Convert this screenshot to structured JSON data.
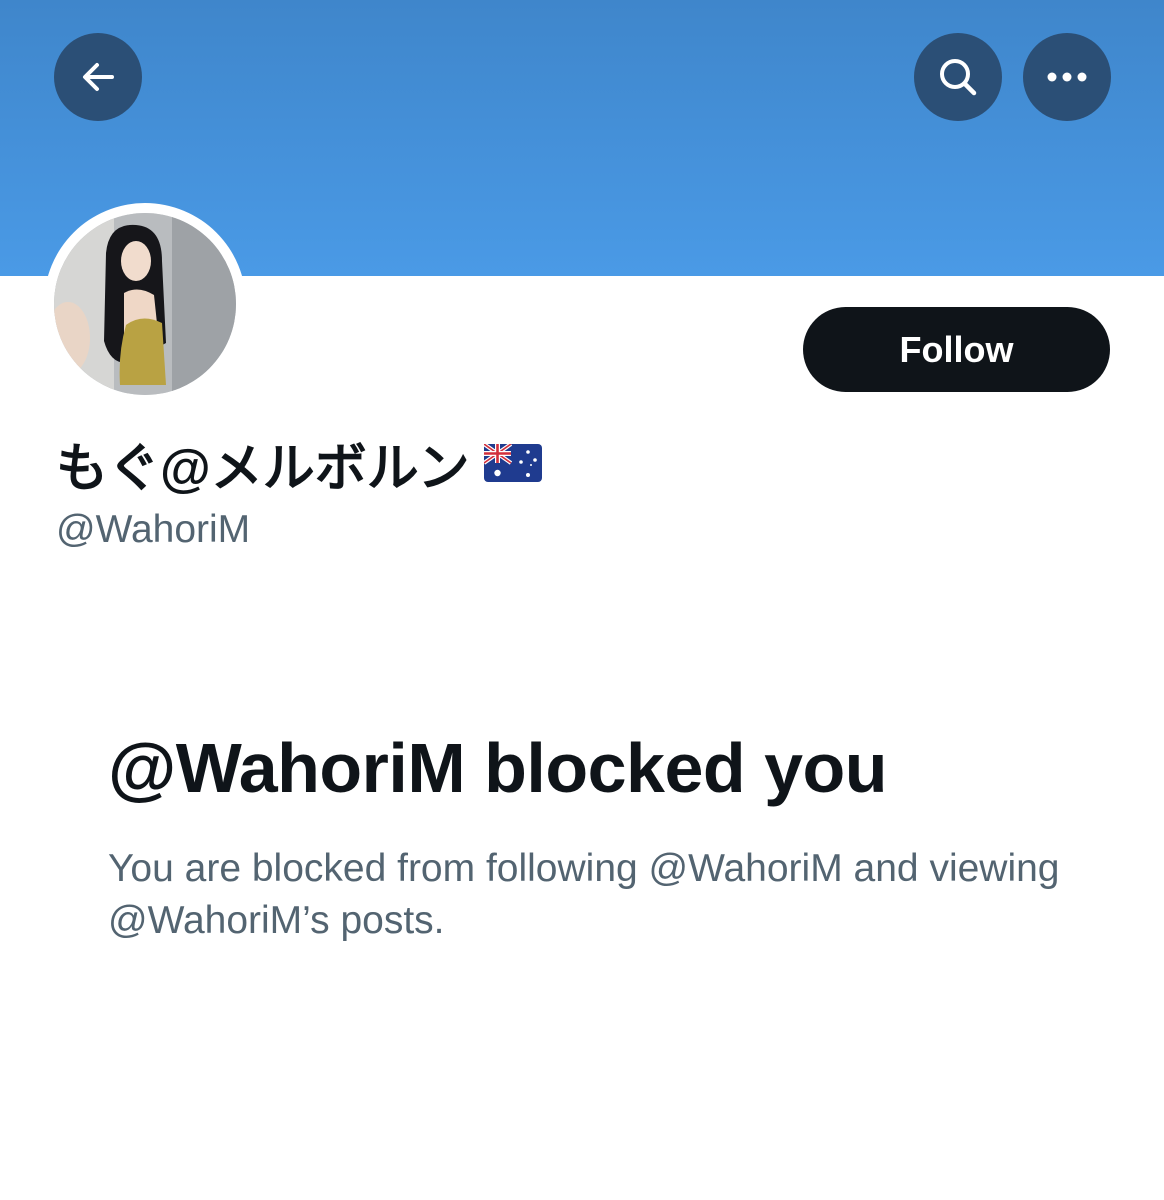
{
  "header": {
    "back_icon": "arrow-left-icon",
    "search_icon": "search-icon",
    "more_icon": "more-horizontal-icon",
    "banner_color": "#4a9ae6",
    "button_color": "#2b4f76"
  },
  "profile": {
    "display_name": "もぐ@メルボルン",
    "flag_icon": "australia-flag-icon",
    "handle": "@WahoriM",
    "follow_label": "Follow"
  },
  "blocked": {
    "title": "@WahoriM blocked you",
    "description": "You are blocked from following @WahoriM and viewing @WahoriM’s posts."
  }
}
